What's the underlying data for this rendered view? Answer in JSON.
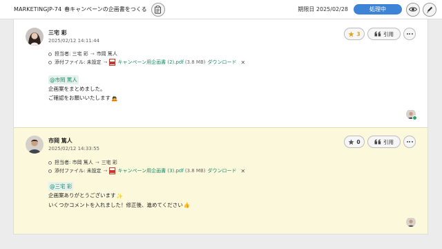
{
  "header": {
    "task_id": "MARKETINGJP-74",
    "task_title": "春キャンペーンの企画書をつくる",
    "due_label": "期限日 2025/02/28",
    "status": "処理中",
    "status_color": "#3d84d6"
  },
  "comments": [
    {
      "author": "三宅 彩",
      "date": "2025/02/12 14:11:44",
      "star_count": "3",
      "quote_label": "引用",
      "assignee_row": {
        "label": "担当者: 三宅 彩",
        "arrow": "→",
        "target": "市岡 篤人"
      },
      "attachment_row": {
        "label": "添付ファイル: 未設定",
        "arrow": "→",
        "file_name": "キャンペーン用企画書 (2).pdf",
        "file_size": "(3.8 MB)",
        "download": "ダウンロード",
        "remove": "✕"
      },
      "mention": "@市岡 篤人",
      "lines": [
        "企画案をまとめました。",
        "ご確認をお願いいたします"
      ],
      "emoji": "🙇"
    },
    {
      "author": "市岡 篤人",
      "date": "2025/02/12 14:33:55",
      "star_count": "0",
      "quote_label": "引用",
      "assignee_row": {
        "label": "担当者: 市岡 篤人",
        "arrow": "→",
        "target": "三宅 彩"
      },
      "attachment_row": {
        "label": "添付ファイル: 未設定",
        "arrow": "→",
        "file_name": "キャンペーン用企画書 (3).pdf",
        "file_size": "(3.8 MB)",
        "download": "ダウンロード",
        "remove": "✕"
      },
      "mention": "@三宅 彩",
      "lines": [
        "企画案ありがとうございます",
        "いくつかコメントを入れました！修正後、進めてください"
      ],
      "emoji_1": "✨",
      "emoji_2": "👍"
    }
  ],
  "icons": [
    "clipboard-icon",
    "eye-icon",
    "pen-icon",
    "star-icon",
    "quote-icon",
    "more-icon",
    "pdf-icon",
    "close-icon"
  ],
  "colors": {
    "accent_green": "#1f8a66",
    "star_gold": "#d9a21c",
    "highlight_bg": "#fbf8dc"
  }
}
